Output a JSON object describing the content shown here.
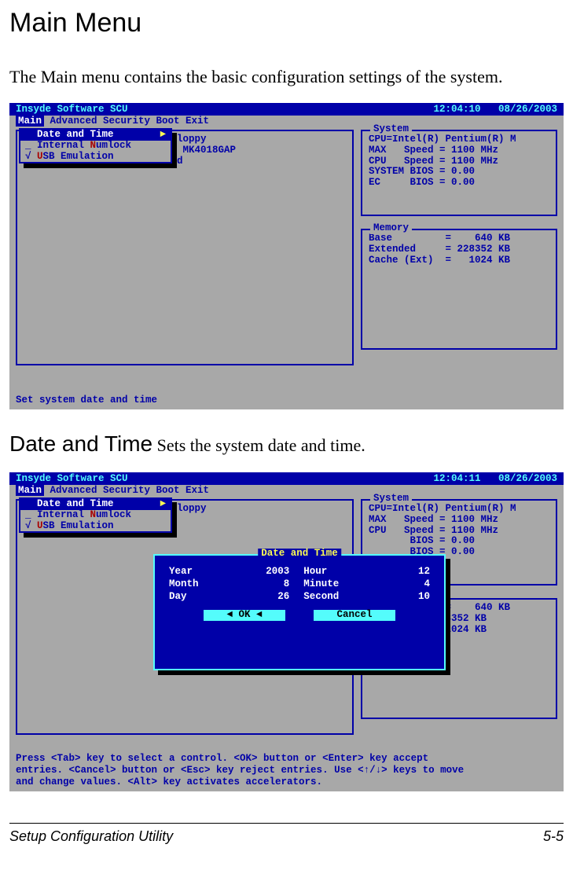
{
  "page": {
    "title": "Main Menu",
    "intro": "The Main menu contains the basic configuration settings of the system.",
    "section2_title": "Date and Time",
    "section2_desc": " Sets the system date and time."
  },
  "bios1": {
    "title": "Insyde Software SCU",
    "time": "12:04:10",
    "date": "08/26/2003",
    "menu": {
      "active": "Main",
      "rest": "  Advanced  Security  Boot  Exit"
    },
    "dropdown": {
      "sel": "Date and Time",
      "r2_pre": "_ Internal ",
      "r2_hot": "N",
      "r2_post": "umlock",
      "r3_pre": "√ ",
      "r3_hot": "U",
      "r3_post": "SB Emulation"
    },
    "main_box": "                       B Floppy\n  IDE Primary    = TOSHIBA MK4018GAP\n  IDE Secondary  = Disabled",
    "system": {
      "legend": "System",
      "content": "CPU=Intel(R) Pentium(R) M\nMAX   Speed = 1100 MHz\nCPU   Speed = 1100 MHz\nSYSTEM BIOS = 0.00\nEC     BIOS = 0.00"
    },
    "memory": {
      "legend": "Memory",
      "content": "Base         =    640 KB\nExtended     = 228352 KB\nCache (Ext)  =   1024 KB"
    },
    "help": "Set system date and time"
  },
  "bios2": {
    "title": "Insyde Software SCU",
    "time": "12:04:11",
    "date": "08/26/2003",
    "menu": {
      "active": "Main",
      "rest": "  Advanced  Security  Boot  Exit"
    },
    "dropdown": {
      "sel": "Date and Time",
      "r2_pre": "_ Internal ",
      "r2_hot": "N",
      "r2_post": "umlock",
      "r3_pre": "√ ",
      "r3_hot": "U",
      "r3_post": "SB Emulation"
    },
    "main_box": "                       B Floppy\n  IDE Primary    =\n  IDE Secondary  =",
    "system": {
      "legend": "System",
      "content": "CPU=Intel(R) Pentium(R) M\nMAX   Speed = 1100 MHz\nCPU   Speed = 1100 MHz\n       BIOS = 0.00\n       BIOS = 0.00"
    },
    "memory": {
      "legend": "Memory",
      "content": "             =    640 KB\n  ed     = 228352 KB\n  (Ext)  =   1024 KB"
    },
    "dialog": {
      "title": "Date and Time",
      "year_l": "Year",
      "year_v": "2003",
      "month_l": "Month",
      "month_v": "8",
      "day_l": "Day",
      "day_v": "26",
      "hour_l": "Hour",
      "hour_v": "12",
      "minute_l": "Minute",
      "minute_v": "4",
      "second_l": "Second",
      "second_v": "10",
      "ok": "OK",
      "cancel": "Cancel"
    },
    "help": "Press <Tab> key to select a control. <OK> button or <Enter> key accept\nentries. <Cancel> button or <Esc> key reject entries. Use <↑/↓> keys to move\nand change values. <Alt> key activates accelerators."
  },
  "footer": {
    "left": "Setup Configuration Utility",
    "right": "5-5"
  }
}
